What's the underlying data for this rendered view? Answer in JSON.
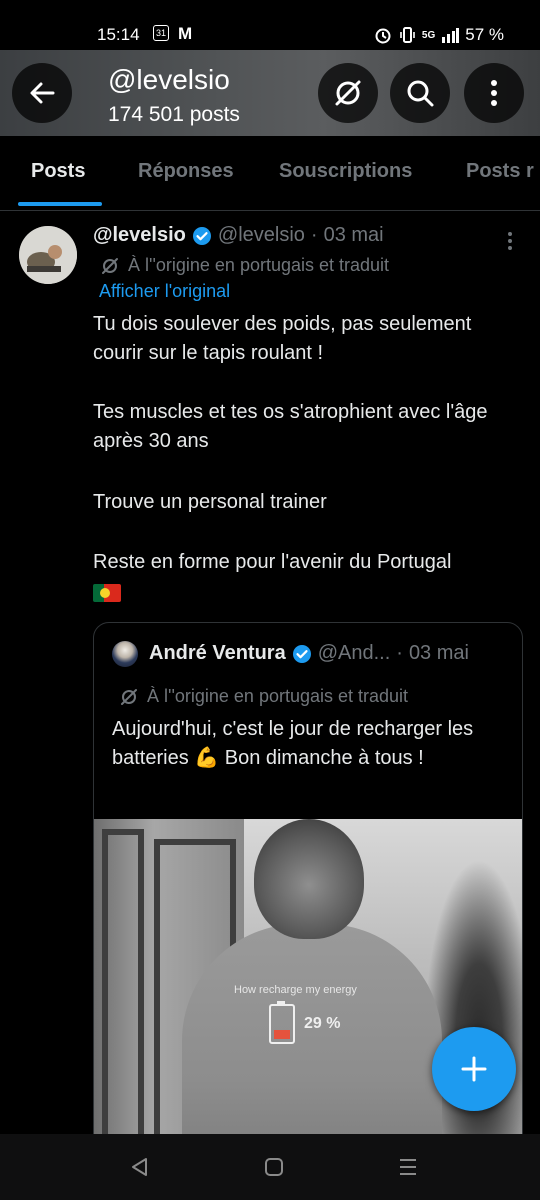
{
  "status_bar": {
    "time": "15:14",
    "calendar_day": "31",
    "gmail_glyph": "M",
    "network": "5G",
    "battery": "57 %"
  },
  "header": {
    "title": "@levelsio",
    "subtitle": "174 501 posts",
    "icons": [
      "back-arrow-icon",
      "grok-icon",
      "search-icon",
      "more-vertical-icon"
    ]
  },
  "tabs": [
    {
      "label": "Posts",
      "active": true
    },
    {
      "label": "Réponses",
      "active": false
    },
    {
      "label": "Souscriptions",
      "active": false
    },
    {
      "label": "Posts r",
      "active": false
    }
  ],
  "post": {
    "display_name": "@levelsio",
    "handle": "@levelsio",
    "separator": "·",
    "date": "03 mai",
    "translation_note": "À l''origine en portugais et traduit",
    "show_original": "Afficher l'original",
    "paragraphs": [
      "Tu dois soulever des poids, pas seulement courir sur le tapis roulant !",
      "Tes muscles et tes os s'atrophient avec l'âge après 30 ans",
      "Trouve un personal trainer",
      "Reste en forme pour l'avenir du Portugal"
    ],
    "flag_emoji": "🇵🇹"
  },
  "quote": {
    "display_name": "André Ventura",
    "handle": "@And...",
    "separator": "·",
    "date": "03 mai",
    "translation_note": "À l''origine en portugais et traduit",
    "text": "Aujourd'hui, c'est le jour de recharger les batteries 💪 Bon dimanche à tous !",
    "media": {
      "shirt_text": "How recharge my energy",
      "battery_percent": "29 %"
    }
  },
  "fab": {
    "icon": "plus-icon"
  },
  "nav": {
    "icons": [
      "nav-back-icon",
      "nav-home-icon",
      "nav-recents-icon"
    ]
  },
  "colors": {
    "accent": "#1d9bf0",
    "background": "#000000",
    "muted": "#71767b",
    "text": "#e7e9ea"
  }
}
